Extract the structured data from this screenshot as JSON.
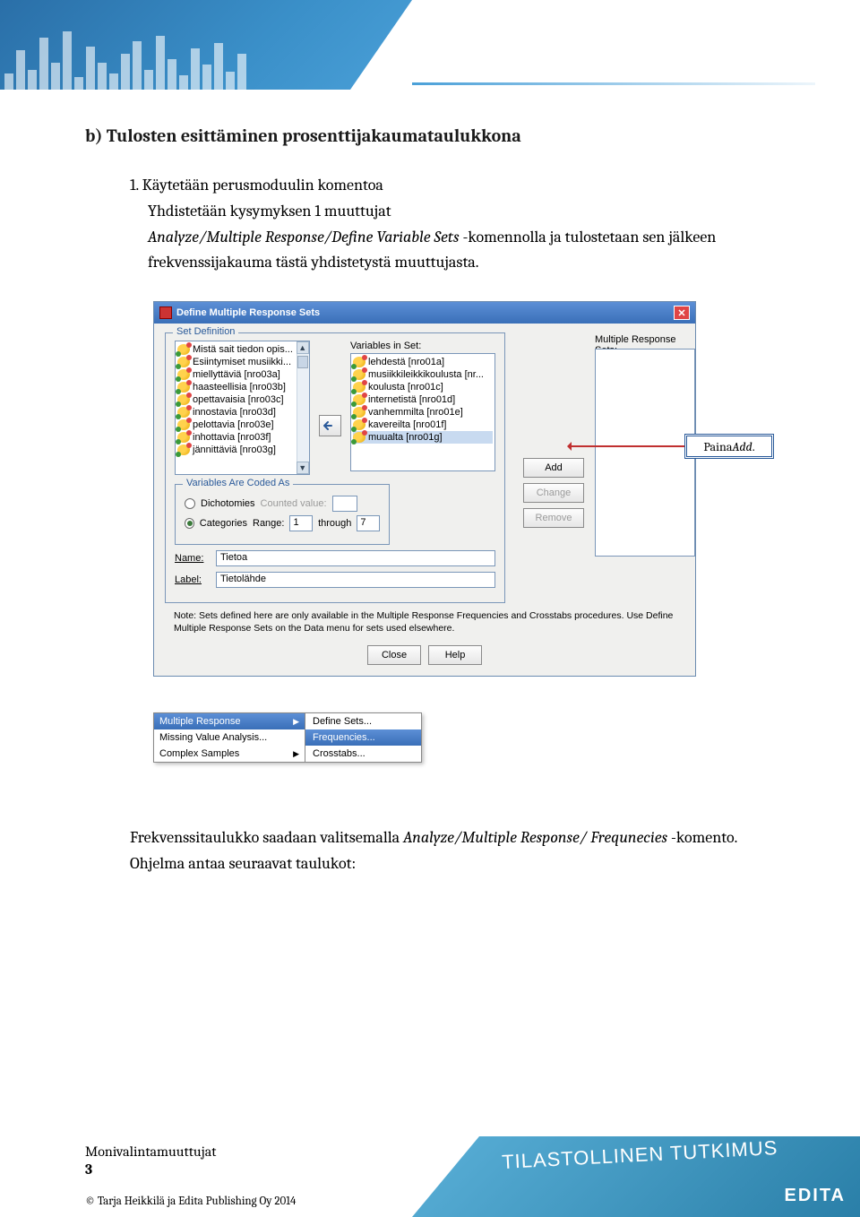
{
  "header": {
    "section_heading": "b) Tulosten esittäminen prosenttijakaumataulukkona"
  },
  "step1": {
    "number": "1.",
    "intro": "Käytetään perusmoduulin komentoa",
    "line1": "Yhdistetään kysymyksen 1 muuttujat",
    "cmd": "Analyze/Multiple Response/Define Variable Sets",
    "line2_a": " -komennolla ja tulostetaan sen jälkeen frekvenssijakauma tästä yhdistetystä muuttujasta."
  },
  "dialog": {
    "title": "Define Multiple Response Sets",
    "set_def_legend": "Set Definition",
    "mrs_label": "Multiple Response Sets:",
    "vars_in_set_label": "Variables in Set:",
    "left_vars": [
      "Mistä sait tiedon opis...",
      "Esiintymiset musiikki...",
      "miellyttäviä [nro03a]",
      "haasteellisia [nro03b]",
      "opettavaisia [nro03c]",
      "innostavia [nro03d]",
      "pelottavia [nro03e]",
      "inhottavia [nro03f]",
      "jännittäviä [nro03g]"
    ],
    "right_vars": [
      "lehdestä [nro01a]",
      "musiikkileikkikoulusta [nr...",
      "koulusta [nro01c]",
      "internetistä [nro01d]",
      "vanhemmilta [nro01e]",
      "kavereilta [nro01f]",
      "muualta [nro01g]"
    ],
    "coded_legend": "Variables Are Coded As",
    "dichot_label": "Dichotomies",
    "counted_label": "Counted value:",
    "cat_label": "Categories",
    "range_label": "Range:",
    "range_from": "1",
    "through_label": "through",
    "range_to": "7",
    "name_label": "Name:",
    "name_val": "Tietoa",
    "label_label": "Label:",
    "label_val": "Tietolähde",
    "note": "Note: Sets defined here are only available in the Multiple Response Frequencies and Crosstabs procedures. Use Define Multiple Response Sets on the Data menu for sets used elsewhere.",
    "add_btn": "Add",
    "change_btn": "Change",
    "remove_btn": "Remove",
    "close_btn": "Close",
    "help_btn": "Help"
  },
  "callout": {
    "prefix": "Paina ",
    "action": "Add",
    "suffix": "."
  },
  "submenu": {
    "left": [
      "Multiple Response",
      "Missing Value Analysis...",
      "Complex Samples"
    ],
    "right": [
      "Define Sets...",
      "Frequencies...",
      "Crosstabs..."
    ]
  },
  "para2": {
    "line_a": "Frekvenssitaulukko saadaan valitsemalla ",
    "cmd": "Analyze/Multiple Response/ Frequnecies ",
    "line_b": "-komento. Ohjelma antaa seuraavat taulukot:"
  },
  "footer": {
    "title": "Monivalintamuuttujat",
    "page": "3",
    "copyright": "© Tarja Heikkilä ja Edita Publishing Oy 2014",
    "brand_top": "TILASTOLLINEN TUTKIMUS",
    "brand": "EDITA"
  }
}
